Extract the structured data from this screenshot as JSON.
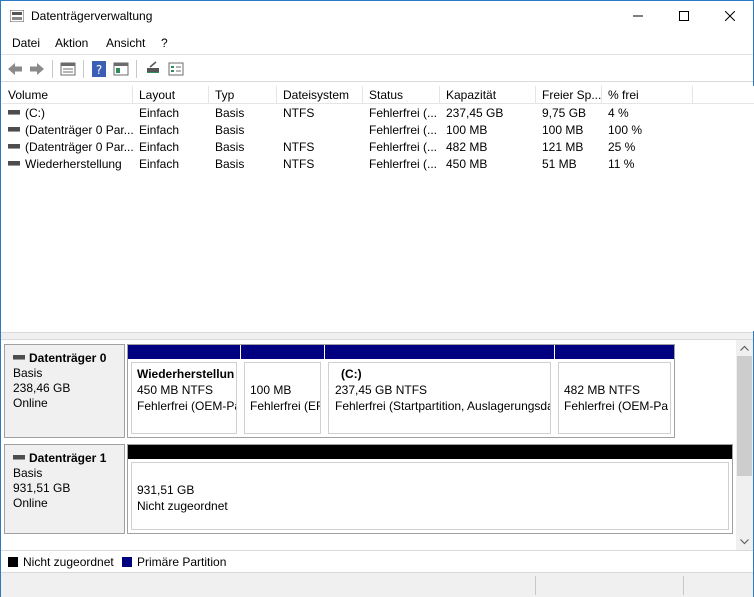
{
  "window": {
    "title": "Datenträgerverwaltung"
  },
  "menu": {
    "items": [
      "Datei",
      "Aktion",
      "Ansicht",
      "?"
    ]
  },
  "colors": {
    "accent": "#000080",
    "unallocated": "#000000",
    "border": "#a0a0a0"
  },
  "toolbar": {
    "icons": [
      "back-arrow-icon",
      "forward-arrow-icon",
      "properties-list-icon",
      "help-icon",
      "console-tree-icon",
      "connect-icon",
      "settings-icon"
    ]
  },
  "volumes": {
    "columns": [
      "Volume",
      "Layout",
      "Typ",
      "Dateisystem",
      "Status",
      "Kapazität",
      "Freier Sp...",
      "% frei"
    ],
    "rows": [
      [
        "(C:)",
        "Einfach",
        "Basis",
        "NTFS",
        "Fehlerfrei (...",
        "237,45 GB",
        "9,75 GB",
        "4 %"
      ],
      [
        "(Datenträger 0 Par...",
        "Einfach",
        "Basis",
        "",
        "Fehlerfrei (...",
        "100 MB",
        "100 MB",
        "100 %"
      ],
      [
        "(Datenträger 0 Par...",
        "Einfach",
        "Basis",
        "NTFS",
        "Fehlerfrei (...",
        "482 MB",
        "121 MB",
        "25 %"
      ],
      [
        "Wiederherstellung",
        "Einfach",
        "Basis",
        "NTFS",
        "Fehlerfrei (...",
        "450 MB",
        "51 MB",
        "11 %"
      ]
    ]
  },
  "disks": [
    {
      "name": "Datenträger 0",
      "type": "Basis",
      "size": "238,46 GB",
      "state": "Online",
      "partitions": [
        {
          "name": "Wiederherstellun",
          "size": "450 MB NTFS",
          "status": "Fehlerfrei (OEM-Pa"
        },
        {
          "name": "",
          "size": "100 MB",
          "status": "Fehlerfrei (EF"
        },
        {
          "name": "(C:)",
          "size": "237,45 GB NTFS",
          "status": "Fehlerfrei (Startpartition, Auslagerungsda"
        },
        {
          "name": "",
          "size": "482 MB NTFS",
          "status": "Fehlerfrei (OEM-Pa"
        }
      ]
    },
    {
      "name": "Datenträger 1",
      "type": "Basis",
      "size": "931,51 GB",
      "state": "Online",
      "partitions": [
        {
          "name": "",
          "size": "931,51 GB",
          "status": "Nicht zugeordnet"
        }
      ]
    }
  ],
  "legend": [
    {
      "label": "Nicht zugeordnet",
      "color": "#000000"
    },
    {
      "label": "Primäre Partition",
      "color": "#000080"
    }
  ]
}
